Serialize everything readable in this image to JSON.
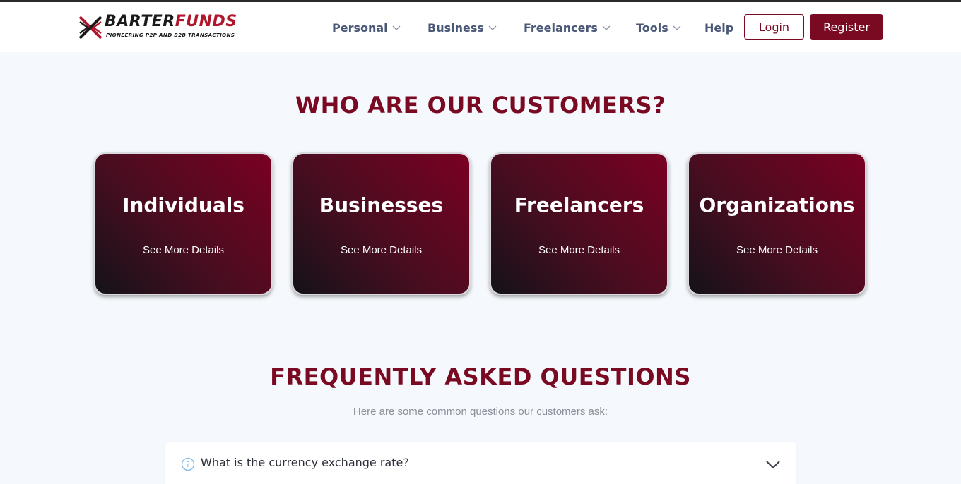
{
  "header": {
    "logo": {
      "word_part1": "BARTER",
      "word_part2": "FUNDS",
      "tagline": "PIONEERING P2P AND B2B TRANSACTIONS"
    },
    "nav": [
      {
        "label": "Personal",
        "has_dropdown": true,
        "icon": "chevron-down-icon"
      },
      {
        "label": "Business",
        "has_dropdown": true,
        "icon": "chevron-down-icon"
      },
      {
        "label": "Freelancers",
        "has_dropdown": true,
        "icon": "chevron-down-icon"
      },
      {
        "label": "Tools",
        "has_dropdown": true,
        "icon": "chevron-down-icon"
      },
      {
        "label": "Help",
        "has_dropdown": false
      }
    ],
    "login_label": "Login",
    "register_label": "Register"
  },
  "customers": {
    "title": "WHO ARE OUR CUSTOMERS?",
    "cards": [
      {
        "title": "Individuals",
        "link": "See More Details"
      },
      {
        "title": "Businesses",
        "link": "See More Details"
      },
      {
        "title": "Freelancers",
        "link": "See More Details"
      },
      {
        "title": "Organizations",
        "link": "See More Details"
      }
    ]
  },
  "faq": {
    "title": "FREQUENTLY ASKED QUESTIONS",
    "subtitle": "Here are some common questions our customers ask:",
    "items": [
      {
        "question": "What is the currency exchange rate?",
        "icon": "question-circle-icon",
        "toggle_icon": "chevron-down-icon"
      }
    ]
  },
  "colors": {
    "brand": "#7a0a22",
    "brand_logo_red": "#b0172c",
    "nav_text": "#4a5878",
    "background": "#f5f8fc",
    "question_icon": "#7fb8e6"
  }
}
